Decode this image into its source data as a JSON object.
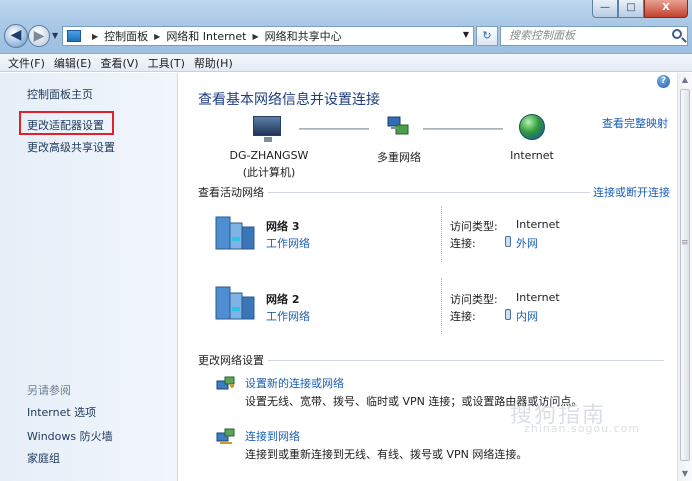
{
  "window": {
    "min_label": "—",
    "max_label": "□",
    "close_label": "X"
  },
  "nav": {
    "back_glyph": "◀",
    "forward_glyph": "▶",
    "dropdown_glyph": "▼"
  },
  "address": {
    "breadcrumbs": [
      "控制面板",
      "网络和 Internet",
      "网络和共享中心"
    ],
    "separator": "▶",
    "dropdown_glyph": "▼",
    "refresh_glyph": "↻"
  },
  "search": {
    "placeholder": "搜索控制面板"
  },
  "menu": [
    "文件(F)",
    "编辑(E)",
    "查看(V)",
    "工具(T)",
    "帮助(H)"
  ],
  "left_panel": {
    "home": "控制面板主页",
    "adapter_settings": "更改适配器设置",
    "advanced_sharing": "更改高级共享设置",
    "see_also_title": "另请参阅",
    "see_also": [
      "Internet 选项",
      "Windows 防火墙",
      "家庭组"
    ]
  },
  "main": {
    "help_glyph": "?",
    "title": "查看基本网络信息并设置连接",
    "full_map_link": "查看完整映射",
    "nodes": {
      "computer_line1": "DG-ZHANGSW",
      "computer_line2": "(此计算机)",
      "multi_network": "多重网络",
      "internet": "Internet"
    },
    "active_section_title": "查看活动网络",
    "connect_link": "连接或断开连接",
    "networks": [
      {
        "name": "网络 3",
        "category": "工作网络",
        "access_label": "访问类型:",
        "access_value": "Internet",
        "conn_label": "连接:",
        "conn_value": "外网"
      },
      {
        "name": "网络 2",
        "category": "工作网络",
        "access_label": "访问类型:",
        "access_value": "Internet",
        "conn_label": "连接:",
        "conn_value": "内网"
      }
    ],
    "change_section_title": "更改网络设置",
    "tasks": [
      {
        "link": "设置新的连接或网络",
        "desc": "设置无线、宽带、拨号、临时或 VPN 连接；或设置路由器或访问点。"
      },
      {
        "link": "连接到网络",
        "desc": "连接到或重新连接到无线、有线、拨号或 VPN 网络连接。"
      }
    ]
  },
  "scrollbar": {
    "up_glyph": "▲",
    "down_glyph": "▼",
    "grip_glyph": "≡"
  },
  "watermark": {
    "main": "搜狗指南",
    "sub": "zhinan.sogou.com"
  }
}
